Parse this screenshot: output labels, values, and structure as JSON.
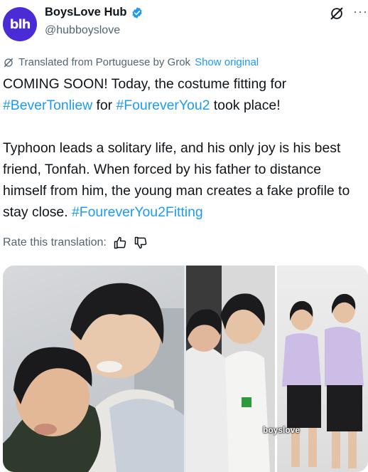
{
  "author": {
    "name": "BoysLove Hub",
    "handle": "@hubboyslove",
    "avatar_text": "blh",
    "verified": true,
    "accent_color": "#4b2bd6"
  },
  "translation": {
    "note": "Translated from Portuguese by Grok",
    "show_original_label": "Show original"
  },
  "tweet": {
    "line1": "COMING SOON! Today, the costume fitting for ",
    "hashtag1": "#BeverTonliew",
    "mid1": " for ",
    "hashtag2": "#FoureverYou2",
    "mid2": " took place!\n\nTyphoon leads a solitary life, and his only joy is his best friend, Tonfah. When forced by his father to distance himself from him, the young man creates a fake profile to stay close. ",
    "hashtag3": "#FoureverYou2Fitting"
  },
  "rating": {
    "label": "Rate this translation:"
  },
  "media": {
    "watermark": "boyslove"
  },
  "colors": {
    "link": "#1d9bf0",
    "secondary_text": "#536471"
  }
}
